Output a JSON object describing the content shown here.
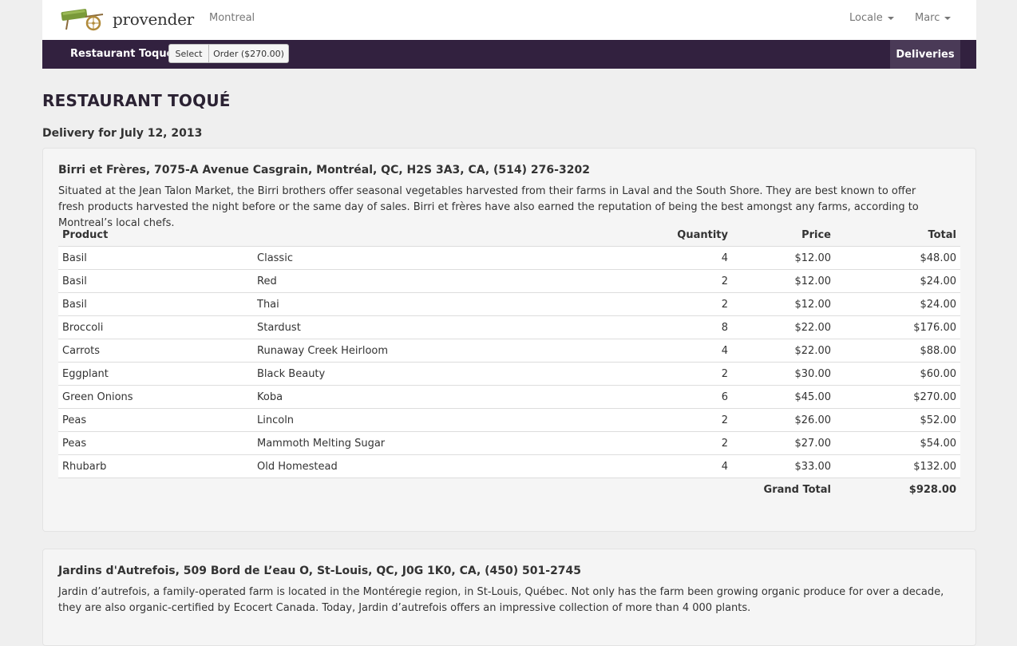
{
  "header": {
    "brand": "provender",
    "city": "Montreal",
    "locale_label": "Locale",
    "user_label": "Marc"
  },
  "subnav": {
    "restaurant": "Restaurant Toqué",
    "select_label": "Select",
    "order_label": "Order ($270.00)",
    "deliveries_label": "Deliveries"
  },
  "page": {
    "title": "RESTAURANT TOQUÉ",
    "delivery": "Delivery for July 12, 2013"
  },
  "farms": [
    {
      "title": "Birri et Frères, 7075-A Avenue Casgrain, Montréal, QC, H2S 3A3, CA, (514) 276-3202",
      "description": "Situated at the Jean Talon Market, the Birri brothers offer seasonal vegetables harvested from their farms in Laval and the South Shore. They are best known to offer fresh products harvested the night before or the same day of sales. Birri et frères have also earned the reputation of being the best amongst any farms, according to Montreal’s local chefs.",
      "columns": {
        "product": "Product",
        "quantity": "Quantity",
        "price": "Price",
        "total": "Total"
      },
      "rows": [
        {
          "product": "Basil",
          "variety": "Classic",
          "quantity": "4",
          "price": "$12.00",
          "total": "$48.00"
        },
        {
          "product": "Basil",
          "variety": "Red",
          "quantity": "2",
          "price": "$12.00",
          "total": "$24.00"
        },
        {
          "product": "Basil",
          "variety": "Thai",
          "quantity": "2",
          "price": "$12.00",
          "total": "$24.00"
        },
        {
          "product": "Broccoli",
          "variety": "Stardust",
          "quantity": "8",
          "price": "$22.00",
          "total": "$176.00"
        },
        {
          "product": "Carrots",
          "variety": "Runaway Creek Heirloom",
          "quantity": "4",
          "price": "$22.00",
          "total": "$88.00"
        },
        {
          "product": "Eggplant",
          "variety": "Black Beauty",
          "quantity": "2",
          "price": "$30.00",
          "total": "$60.00"
        },
        {
          "product": "Green Onions",
          "variety": "Koba",
          "quantity": "6",
          "price": "$45.00",
          "total": "$270.00"
        },
        {
          "product": "Peas",
          "variety": "Lincoln",
          "quantity": "2",
          "price": "$26.00",
          "total": "$52.00"
        },
        {
          "product": "Peas",
          "variety": "Mammoth Melting Sugar",
          "quantity": "2",
          "price": "$27.00",
          "total": "$54.00"
        },
        {
          "product": "Rhubarb",
          "variety": "Old Homestead",
          "quantity": "4",
          "price": "$33.00",
          "total": "$132.00"
        }
      ],
      "grand_total_label": "Grand Total",
      "grand_total": "$928.00"
    },
    {
      "title": "Jardins d'Autrefois, 509 Bord de L’eau O, St-Louis, QC, J0G 1K0, CA, (450) 501-2745",
      "description": "Jardin d’autrefois, a family-operated farm is located in the Montéregie region, in St-Louis, Québec. Not only has the farm been growing organic produce for over a decade, they are also organic-certified by Ecocert Canada. Today, Jardin d’autrefois offers an impressive collection of more than 4 000 plants."
    }
  ],
  "icons": {
    "brand_logo": "wheelbarrow-icon",
    "caret": "caret-down-icon"
  },
  "colors": {
    "subnav_bg": "#32213f",
    "subnav_active": "#4a3a57",
    "page_bg": "#efefef"
  }
}
